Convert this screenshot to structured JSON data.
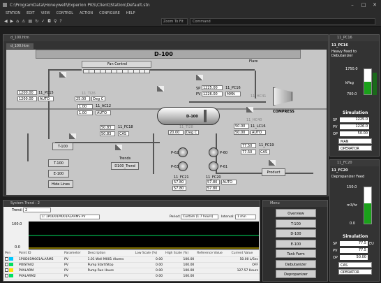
{
  "app": {
    "title": "C:\\ProgramData\\Honeywell\\Experion PKS\\Client\\Station\\Default.stn"
  },
  "menu": [
    "STATION",
    "EDIT",
    "VIEW",
    "CONTROL",
    "ACTION",
    "CONFIGURE",
    "HELP"
  ],
  "toolbar": {
    "zoom": "Zoom To Fit",
    "command": "Command"
  },
  "view": {
    "tab": "d_100.htm",
    "inner_tab": "d_100.htm",
    "title": "D-100",
    "fan_control": "Fan Control",
    "flare": "Flare",
    "compress": "COMPRESS",
    "pc16": {
      "sp": "1225.00",
      "pv": "1226.00",
      "tag": "11_PC16",
      "mode": "MAN"
    },
    "pc15": {
      "tag": "11_PC15",
      "sp": "1200.00",
      "pv": "1200.00",
      "mode": "AUTO"
    },
    "ti26": {
      "tag": "11_TI26",
      "val": "25.00",
      "unit": "Deg C"
    },
    "ac12": {
      "tag": "11_AC12",
      "sp": "1.00",
      "pv": "1.00",
      "mode": "AUTO"
    },
    "fc18": {
      "tag": "11_FC18",
      "sp": "50.83",
      "pv": "50.83",
      "mode": "CAS"
    },
    "ti28": {
      "tag": "11_TI28",
      "val": "20.00",
      "unit": "Deg C"
    },
    "lc16": {
      "tag": "11_LC16",
      "sp": "50.00",
      "pv": "50.00",
      "mode": "AUTO"
    },
    "hc41": "11_HC41",
    "hc40": "11_HC40",
    "fc19": {
      "tag": "11_FC19",
      "sp": "77.50",
      "pv": "77.50",
      "mode": "CAS"
    },
    "fc20": {
      "tag": "11_FC20",
      "sp": "57.80",
      "pv": "57.80",
      "mode": "AUTO"
    },
    "fc21": {
      "tag": "11_FC21",
      "sp": "57.80",
      "pv": "57.80",
      "mode": "AUTO"
    },
    "d100": "D-100",
    "t100": "T-100",
    "e100": "E-100",
    "hide": "Hide Lines",
    "trends": "Trends",
    "trend_btn": "D100_Trend",
    "p62": "P-62",
    "p60": "P-60",
    "p63": "P-63",
    "p61": "P-61",
    "product": "Product",
    "sp": "SP",
    "pv": "PV",
    "op": "OP"
  },
  "right1": {
    "header": "11_PC16",
    "tag": "11_PC16",
    "desc": "Heavy Feed to Debutanizer",
    "scale_top": "1750.0",
    "scale_bot": "700.0",
    "unit": "kPag",
    "sim": "Simulation",
    "sp": "1225.0",
    "pv": "1226.0",
    "op": "50.00",
    "mode": "MAN",
    "role": "OPERATOR"
  },
  "right2": {
    "header": "11_FC20",
    "tag": "11_FC20",
    "desc": "Depropanizer Feed",
    "scale_top": "150.0",
    "scale_bot": "0.0",
    "unit": "m3/hr",
    "sim": "Simulation",
    "sp": "77.5",
    "pv": "77.5",
    "op": "50.00",
    "mode": "CAS",
    "role": "OPERATOR",
    "eu": "EU"
  },
  "trend": {
    "title": "System Trend : 2",
    "label": "Trend:",
    "num": "2",
    "point": "1: 1POD01M001ALARMS PV",
    "period_l": "Period:",
    "period": "Custom (1.7 hours)",
    "interval_l": "Interval:",
    "interval": "1 min",
    "y_top": "100.0",
    "y_bot": "0.0",
    "cols": [
      "Pen",
      "Point ID",
      "Parameter",
      "Description",
      "Low Scale (%)",
      "High Scale (%)",
      "Reference Value",
      "Current Value"
    ],
    "rows": [
      [
        "1POD01M001ALARMS",
        "PV",
        "1.01 Well M001 Alarms",
        "0.00",
        "100.00",
        "",
        "50.00 L/Sec"
      ],
      [
        "POISTA02",
        "PV",
        "Pump Start/Stop",
        "0.00",
        "100.00",
        "",
        "OFF"
      ],
      [
        "PVALARM",
        "PV",
        "Pump Run Hours",
        "0.00",
        "100.00",
        "",
        "127.57 Hours"
      ],
      [
        "PVALARM2",
        "PV",
        "",
        "0.00",
        "100.00",
        "",
        ""
      ]
    ]
  },
  "nav": {
    "title": "Menu",
    "buttons": [
      "Overview",
      "T-100",
      "D-100",
      "E-100",
      "Tank Farm",
      "Debutanizer",
      "Depropanizer"
    ]
  },
  "colors": {
    "tank_fill": "#1aa11a",
    "pen1": "#00c8ff",
    "pen2": "#00e060",
    "pen3": "#ffe000"
  }
}
